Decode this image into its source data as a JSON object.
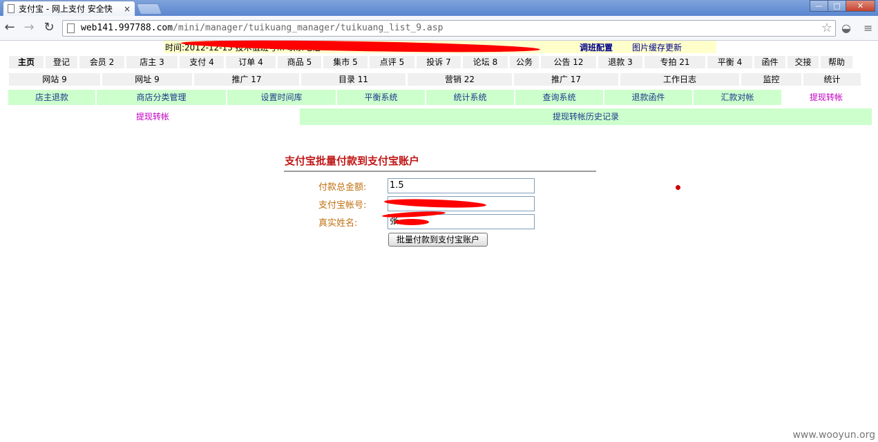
{
  "browser": {
    "tab_title": "支付宝 - 网上支付 安全快",
    "tab_close": "×",
    "url_host": "web141.997788.com",
    "url_path": "/mini/manager/tuikuang_manager/tuikuang_list_9.asp",
    "back": "←",
    "forward": "→",
    "reload": "↻",
    "star": "☆",
    "win_min": "—",
    "win_max": "□",
    "win_close": "✕"
  },
  "infobar": {
    "time_text": "时间:2012-12-13 技术值班号... 联系电话:15059688172",
    "config_link": "调班配置",
    "cache_link": "图片缓存更新"
  },
  "nav_row1": [
    {
      "label": "主页"
    },
    {
      "label": "登记"
    },
    {
      "label": "会员 2"
    },
    {
      "label": "店主 3"
    },
    {
      "label": "支付 4"
    },
    {
      "label": "订单 4"
    },
    {
      "label": "商品 5"
    },
    {
      "label": "集市 5"
    },
    {
      "label": "点评 5"
    },
    {
      "label": "投诉 7"
    },
    {
      "label": "论坛 8"
    },
    {
      "label": "公务"
    },
    {
      "label": "公告 12"
    },
    {
      "label": "退款 3"
    },
    {
      "label": "专拍 21"
    },
    {
      "label": "平衡 4"
    },
    {
      "label": "函件"
    },
    {
      "label": "交接"
    },
    {
      "label": "帮助"
    }
  ],
  "nav_row2": [
    {
      "label": "网站 9"
    },
    {
      "label": "网址 9"
    },
    {
      "label": "推广 17"
    },
    {
      "label": "目录 11"
    },
    {
      "label": "营销 22"
    },
    {
      "label": "推广 17"
    },
    {
      "label": "工作日志"
    },
    {
      "label": "监控"
    },
    {
      "label": "统计"
    }
  ],
  "nav_row3": [
    {
      "label": "店主退款"
    },
    {
      "label": "商店分类管理"
    },
    {
      "label": "设置时间库"
    },
    {
      "label": "平衡系统"
    },
    {
      "label": "统计系统"
    },
    {
      "label": "查询系统"
    },
    {
      "label": "退款函件"
    },
    {
      "label": "汇款对帐"
    },
    {
      "label": "提现转帐"
    }
  ],
  "nav_row4": [
    {
      "label": "提现转帐"
    },
    {
      "label": "提现转帐历史记录"
    }
  ],
  "form": {
    "title": "支付宝批量付款到支付宝账户",
    "amount_label": "付款总金额:",
    "amount_value": "1.5",
    "account_label": "支付宝帐号:",
    "account_value": "",
    "name_label": "真实姓名:",
    "name_value": "张",
    "submit_label": "批量付款到支付宝账户"
  },
  "watermark": "www.wooyun.org",
  "colors": {
    "green_nav": "#ccffcc",
    "active_link": "#c000c0",
    "form_title": "#c01616",
    "label": "#c07010",
    "redaction": "#ff0000"
  }
}
